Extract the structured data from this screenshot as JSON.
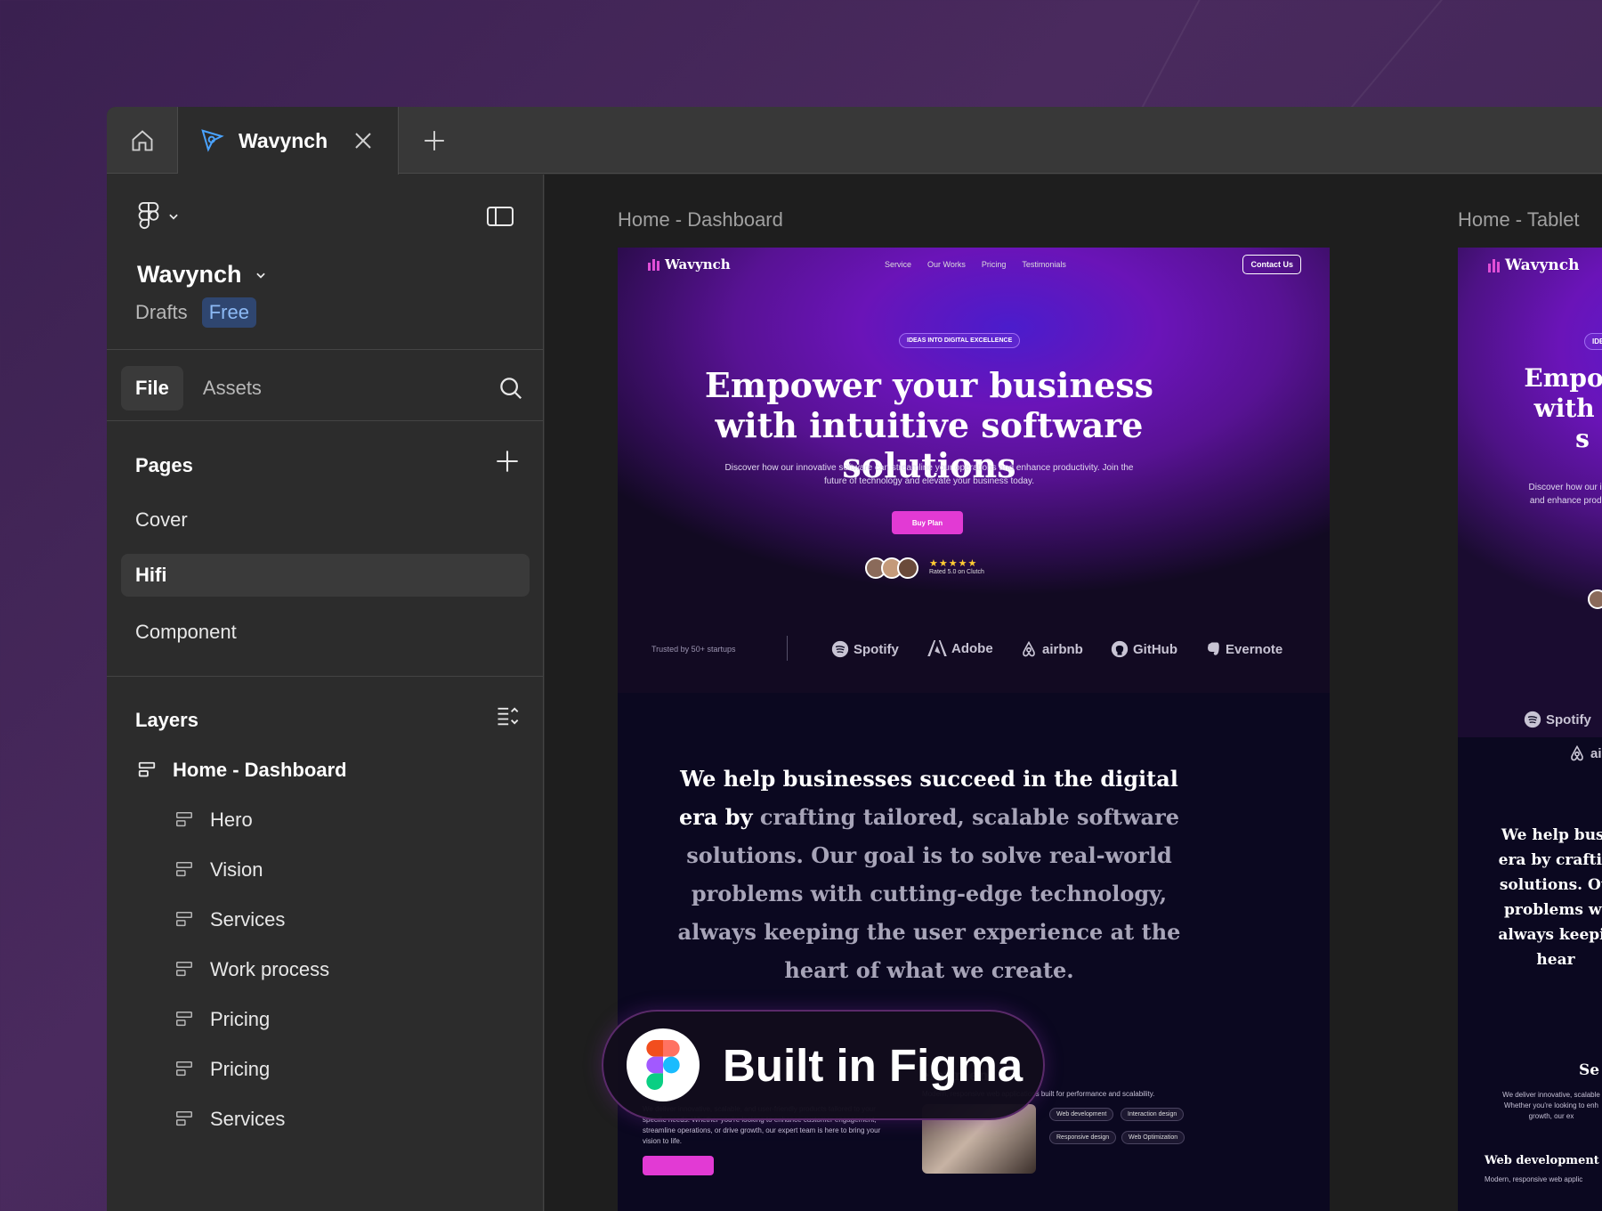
{
  "window": {
    "tabs": {
      "home_icon": "home-icon",
      "file_tab_title": "Wavynch",
      "close_icon": "close-icon",
      "new_tab_icon": "plus-icon"
    }
  },
  "sidebar": {
    "project_name": "Wavynch",
    "drafts_label": "Drafts",
    "plan_badge": "Free",
    "tabs": {
      "file": "File",
      "assets": "Assets"
    },
    "pages_title": "Pages",
    "pages": [
      {
        "label": "Cover",
        "active": false
      },
      {
        "label": "Hifi",
        "active": true
      },
      {
        "label": "Component",
        "active": false
      }
    ],
    "layers_title": "Layers",
    "layers": [
      {
        "label": "Home - Dashboard",
        "level": 0
      },
      {
        "label": "Hero",
        "level": 1
      },
      {
        "label": "Vision",
        "level": 1
      },
      {
        "label": "Services",
        "level": 1
      },
      {
        "label": "Work process",
        "level": 1
      },
      {
        "label": "Pricing",
        "level": 1
      },
      {
        "label": "Pricing",
        "level": 1
      },
      {
        "label": "Services",
        "level": 1
      }
    ]
  },
  "canvas": {
    "frame_labels": {
      "dashboard": "Home - Dashboard",
      "tablet": "Home - Tablet"
    },
    "dashboard": {
      "logo": "Wavynch",
      "nav": [
        "Service",
        "Our Works",
        "Pricing",
        "Testimonials"
      ],
      "contact": "Contact Us",
      "pill": "IDEAS INTO DIGITAL EXCELLENCE",
      "headline": "Empower your business with intuitive software solutions",
      "subtext": "Discover how our innovative software can streamline your operations and enhance productivity. Join the future of technology and elevate your business today.",
      "cta": "Buy Plan",
      "stars": "★★★★★",
      "rating_text": "Rated 5.0 on Clutch",
      "trusted": "Trusted by 50+ startups",
      "brands": [
        "Spotify",
        "Adobe",
        "airbnb",
        "GitHub",
        "Evernote"
      ],
      "vision_highlight": "We help businesses succeed in the digital era by",
      "vision_rest": "crafting tailored, scalable software solutions. Our goal is to solve real-world problems with cutting-edge technology, always keeping the user experience at the heart of what we create.",
      "services_text": "We deliver innovative, scalable, and user-friendly products tailored to your specific needs. Whether you're looking to enhance customer engagement, streamline operations, or drive growth, our expert team is here to bring your vision to life.",
      "web_title_partial": "elopment",
      "web_sub": "Modern, responsive web applications built for performance and scalability.",
      "tags": [
        "Web development",
        "Interaction design",
        "Responsive design",
        "Web Optimization"
      ]
    },
    "tablet": {
      "logo": "Wavynch",
      "pill_partial": "IDE",
      "headline_lines": [
        "Empowe",
        "with in",
        "s"
      ],
      "subtext_lines": [
        "Discover how our inno",
        "and enhance producti"
      ],
      "brands": [
        "Spotify",
        "ai"
      ],
      "vision_lines": [
        "We help busi",
        "era by craftin",
        "solutions. Ou",
        "problems wi",
        "always keepir",
        "hear"
      ],
      "services_partial": "Se",
      "services_lines": [
        "We deliver innovative, scalable",
        "Whether you're looking to enh",
        "growth, our ex"
      ],
      "web_title": "Web development",
      "web_sub_partial": "Modern, responsive web applic"
    },
    "badge": "Built in Figma"
  },
  "colors": {
    "accent": "#e23ad4",
    "free_badge_bg": "#2f4670",
    "free_badge_text": "#8dbaf5"
  }
}
